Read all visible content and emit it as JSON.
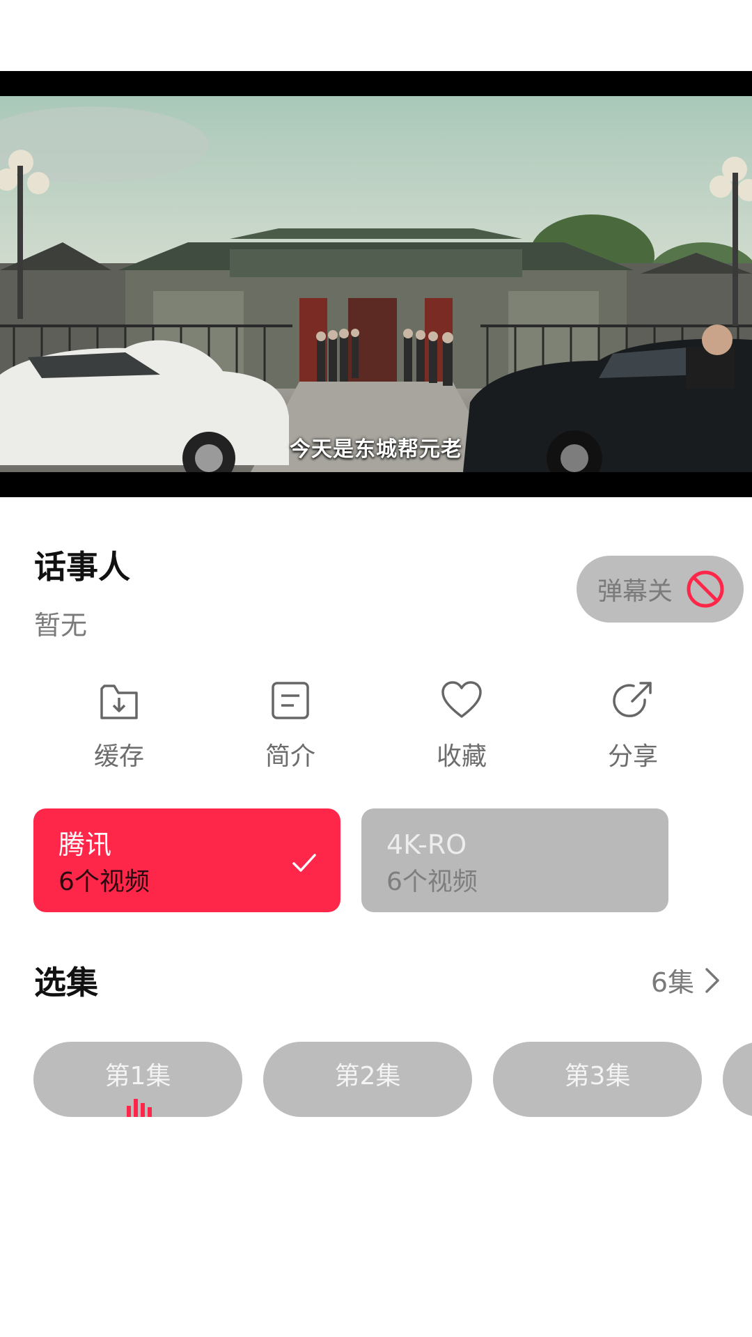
{
  "player": {
    "subtitle": "今天是东城帮元老"
  },
  "show": {
    "title": "话事人",
    "description": "暂无"
  },
  "danmaku": {
    "label": "弹幕关",
    "icon": "no-danmaku-icon"
  },
  "actions": [
    {
      "label": "缓存",
      "icon": "download-folder-icon"
    },
    {
      "label": "简介",
      "icon": "document-icon"
    },
    {
      "label": "收藏",
      "icon": "heart-icon"
    },
    {
      "label": "分享",
      "icon": "share-icon"
    }
  ],
  "sources": [
    {
      "name": "腾讯",
      "count": "6个视频",
      "selected": true
    },
    {
      "name": "4K-RO",
      "count": "6个视频",
      "selected": false
    }
  ],
  "episodes_section": {
    "title": "选集",
    "count": "6集"
  },
  "episodes": [
    {
      "label": "第1集",
      "playing": true
    },
    {
      "label": "第2集",
      "playing": false
    },
    {
      "label": "第3集",
      "playing": false
    },
    {
      "label": "",
      "playing": false
    }
  ],
  "colors": {
    "accent": "#ff2749",
    "pill_gray": "#bcbcbc",
    "card_gray": "#b9b9b9"
  }
}
